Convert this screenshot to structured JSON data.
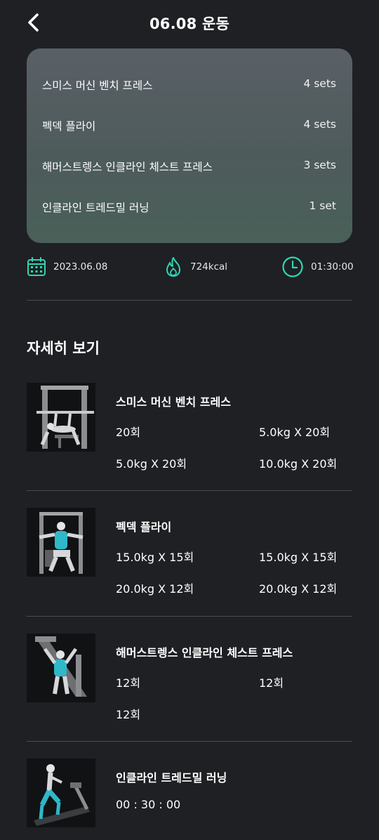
{
  "header": {
    "title": "06.08 운동"
  },
  "summary": [
    {
      "name": "스미스 머신 벤치 프레스",
      "sets": "4 sets"
    },
    {
      "name": "펙덱 플라이",
      "sets": "4 sets"
    },
    {
      "name": "해머스트렝스 인클라인 체스트 프레스",
      "sets": "3 sets"
    },
    {
      "name": "인클라인 트레드밀 러닝",
      "sets": "1 set"
    }
  ],
  "stats": {
    "date": "2023.06.08",
    "calories": "724kcal",
    "duration": "01:30:00"
  },
  "detail_title": "자세히 보기",
  "exercises": [
    {
      "name": "스미스 머신 벤치 프레스",
      "sets": [
        "20회",
        "5.0kg X 20회",
        "5.0kg X 20회",
        "10.0kg X 20회"
      ]
    },
    {
      "name": "펙덱 플라이",
      "sets": [
        "15.0kg X 15회",
        "15.0kg X 15회",
        "20.0kg X 12회",
        "20.0kg X 12회"
      ]
    },
    {
      "name": "해머스트렝스 인클라인 체스트 프레스",
      "sets": [
        "12회",
        "12회",
        "12회"
      ]
    },
    {
      "name": "인클라인 트레드밀 러닝",
      "sets": [
        "00 : 30 : 00"
      ]
    }
  ],
  "colors": {
    "accent": "#2fd6b2",
    "background": "#1f2024"
  }
}
